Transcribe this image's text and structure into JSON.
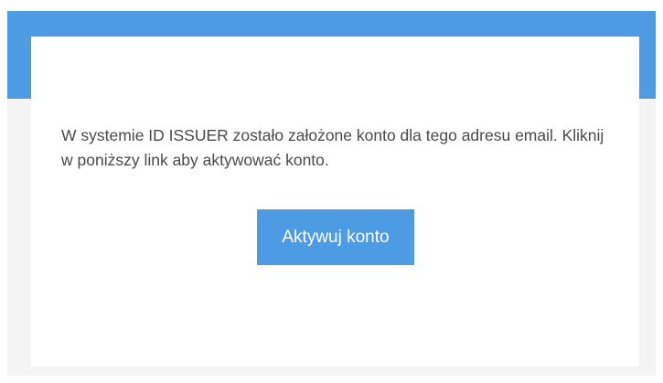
{
  "email": {
    "message": "W systemie ID ISSUER zostało założone konto dla tego adresu email. Kliknij w poniższy link aby aktywować konto.",
    "button_label": "Aktywuj konto"
  },
  "colors": {
    "accent": "#4c9be3",
    "background": "#f4f4f4",
    "card": "#ffffff",
    "text": "#4a4a4a"
  }
}
